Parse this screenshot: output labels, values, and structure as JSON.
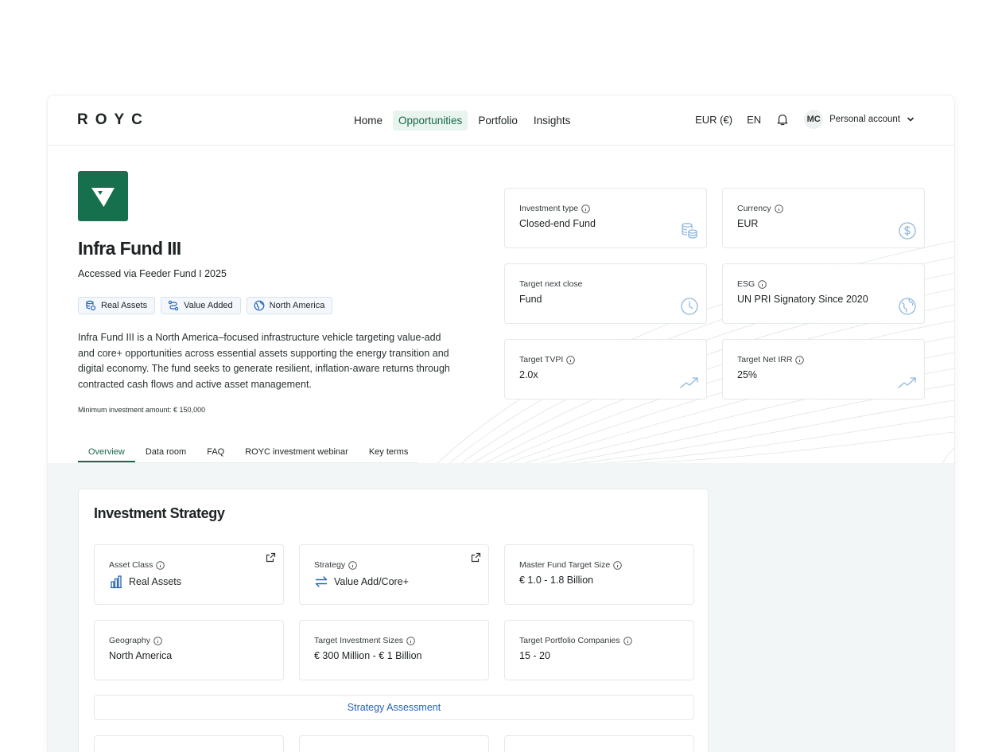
{
  "brand": {
    "logo_text": "ROYC",
    "accent": "#17704d",
    "link": "#2563b8"
  },
  "nav": {
    "items": [
      {
        "label": "Home",
        "active": false
      },
      {
        "label": "Opportunities",
        "active": true
      },
      {
        "label": "Portfolio",
        "active": false
      },
      {
        "label": "Insights",
        "active": false
      }
    ]
  },
  "header": {
    "currency": "EUR (€)",
    "language": "EN",
    "notifications_icon": "bell-icon",
    "avatar_initials": "MC",
    "account_label": "Personal account"
  },
  "fund": {
    "name": "Infra Fund III",
    "subtitle": "Accessed via Feeder Fund I 2025",
    "tags": [
      {
        "label": "Real Assets",
        "icon": "coins-stack-icon"
      },
      {
        "label": "Value Added",
        "icon": "route-icon"
      },
      {
        "label": "North America",
        "icon": "globe-icon"
      }
    ],
    "description": "Infra Fund III is a North America–focused infrastructure vehicle targeting value-add and core+ opportunities across essential assets supporting the energy transition and digital economy. The fund seeks to generate resilient, inflation-aware returns through contracted cash flows and active asset management.",
    "min_investment": "Minimum investment amount: € 150,000"
  },
  "tabs": [
    {
      "label": "Overview",
      "active": true
    },
    {
      "label": "Data room",
      "active": false
    },
    {
      "label": "FAQ",
      "active": false
    },
    {
      "label": "ROYC investment webinar",
      "active": false
    },
    {
      "label": "Key terms",
      "active": false
    }
  ],
  "kpis": [
    {
      "label": "Investment type",
      "value": "Closed-end Fund",
      "icon": "coins-icon"
    },
    {
      "label": "Currency",
      "value": "EUR",
      "icon": "dollar-circle-icon"
    },
    {
      "label": "Target next close",
      "value": "Fund",
      "icon": "clock-icon"
    },
    {
      "label": "ESG",
      "value": "UN PRI Signatory Since 2020",
      "icon": "globe-icon"
    },
    {
      "label": "Target TVPI",
      "value": "2.0x",
      "icon": "trend-up-icon"
    },
    {
      "label": "Target Net IRR",
      "value": "25%",
      "icon": "trend-up-icon"
    }
  ],
  "strategy": {
    "title": "Investment Strategy",
    "cells": [
      {
        "label": "Asset Class",
        "value": "Real Assets",
        "icon": "bar-chart-icon",
        "external": true
      },
      {
        "label": "Strategy",
        "value": "Value Add/Core+",
        "icon": "swap-arrows-icon",
        "external": true
      },
      {
        "label": "Master Fund Target Size",
        "value": "€ 1.0 - 1.8 Billion",
        "icon": "",
        "external": false
      },
      {
        "label": "Geography",
        "value": "North America",
        "icon": "",
        "external": false
      },
      {
        "label": "Target Investment Sizes",
        "value": "€ 300 Million - € 1 Billion",
        "icon": "",
        "external": false
      },
      {
        "label": "Target Portfolio Companies",
        "value": "15 - 20",
        "icon": "",
        "external": false
      }
    ],
    "assessment_label": "Strategy Assessment"
  }
}
